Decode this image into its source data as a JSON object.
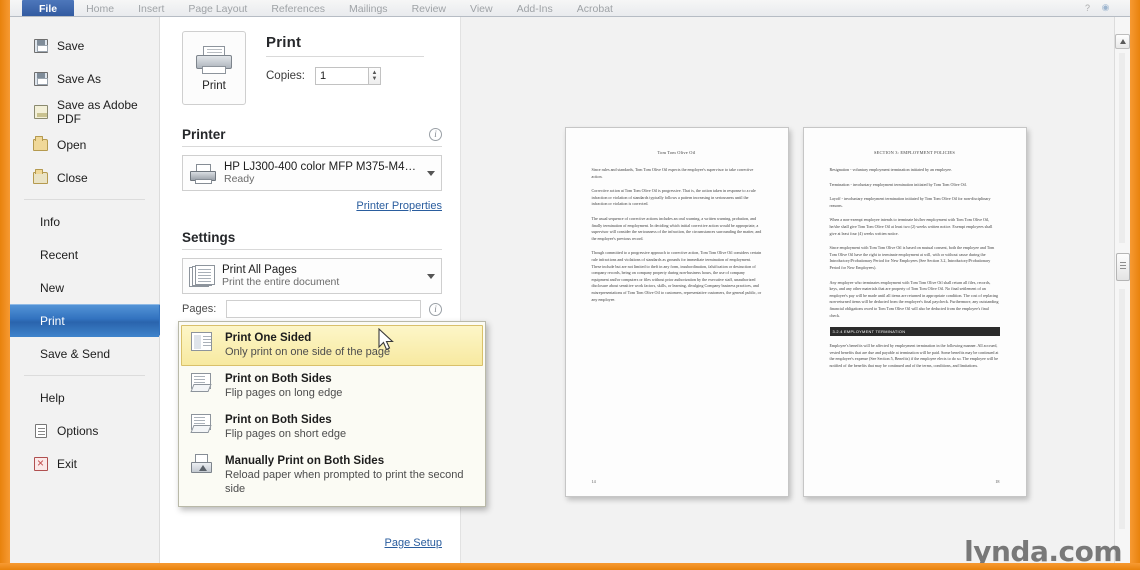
{
  "ribbon": {
    "tabs": [
      {
        "label": "File",
        "active": true
      },
      {
        "label": "Home",
        "active": false
      },
      {
        "label": "Insert",
        "active": false
      },
      {
        "label": "Page Layout",
        "active": false
      },
      {
        "label": "References",
        "active": false
      },
      {
        "label": "Mailings",
        "active": false
      },
      {
        "label": "Review",
        "active": false
      },
      {
        "label": "View",
        "active": false
      },
      {
        "label": "Add-Ins",
        "active": false
      },
      {
        "label": "Acrobat",
        "active": false
      }
    ],
    "help_icon": "help-icon",
    "globe_icon": "globe-icon"
  },
  "nav": {
    "items": [
      {
        "label": "Save",
        "icon": "save-disk-icon"
      },
      {
        "label": "Save As",
        "icon": "save-as-disk-icon"
      },
      {
        "label": "Save as Adobe PDF",
        "icon": "pdf-icon"
      },
      {
        "label": "Open",
        "icon": "open-folder-icon"
      },
      {
        "label": "Close",
        "icon": "close-folder-icon"
      },
      {
        "label": "Info",
        "icon": ""
      },
      {
        "label": "Recent",
        "icon": ""
      },
      {
        "label": "New",
        "icon": ""
      },
      {
        "label": "Print",
        "icon": "",
        "selected": true
      },
      {
        "label": "Save & Send",
        "icon": ""
      },
      {
        "label": "Help",
        "icon": ""
      },
      {
        "label": "Options",
        "icon": "options-icon"
      },
      {
        "label": "Exit",
        "icon": "exit-icon"
      }
    ]
  },
  "print_panel": {
    "button_label": "Print",
    "heading": "Print",
    "copies_label": "Copies:",
    "copies_value": "1",
    "printer_section": {
      "heading": "Printer",
      "info_badge": "i",
      "selected_printer": "HP LJ300-400 color MFP M375-M475 PCL 6",
      "status": "Ready",
      "properties_link": "Printer Properties"
    },
    "settings_section": {
      "heading": "Settings",
      "print_range": {
        "title": "Print All Pages",
        "subtitle": "Print the entire document"
      },
      "pages_label": "Pages:",
      "pages_value": "",
      "pages_placeholder": "",
      "pages_info_badge": "i",
      "sides": {
        "title": "Print One Sided",
        "subtitle": "Only print on one side of the page"
      }
    },
    "page_setup_link": "Page Setup"
  },
  "dropdown": {
    "options": [
      {
        "title": "Print One Sided",
        "subtitle": "Only print on one side of the page",
        "icon": "one-sided-page-icon",
        "selected": true
      },
      {
        "title": "Print on Both Sides",
        "subtitle": "Flip pages on long edge",
        "icon": "both-sides-long-edge-icon",
        "selected": false
      },
      {
        "title": "Print on Both Sides",
        "subtitle": "Flip pages on short edge",
        "icon": "both-sides-short-edge-icon",
        "selected": false
      },
      {
        "title": "Manually Print on Both Sides",
        "subtitle": "Reload paper when prompted to print the second side",
        "icon": "manual-both-sides-icon",
        "selected": false
      }
    ]
  },
  "preview": {
    "left_page": {
      "title": "Tom Tom Olive Oil",
      "page_number": "14",
      "paragraphs": [
        "Since rules and standards, Tom Tom Olive Oil expects the employee's supervisor to take corrective action.",
        "Corrective action at Tom Tom Olive Oil is progressive. That is, the action taken in response to a rule infraction or violation of standards typically follows a pattern increasing in seriousness until the infraction or violation is corrected.",
        "The usual sequence of corrective actions includes an oral warning, a written warning, probation, and finally termination of employment. In deciding which initial corrective action would be appropriate, a supervisor will consider the seriousness of the infraction, the circumstances surrounding the matter, and the employee's previous record.",
        "Though committed to a progressive approach to corrective action, Tom Tom Olive Oil considers certain rule infractions and violations of standards as grounds for immediate termination of employment. These include but are not limited to theft in any form, insubordination, falsification or destruction of company records, being on company property during non-business hours, the use of company equipment and/or computers or files without prior authorization by the executive staff, unauthorized disclosure about sensitive work factors, skills, or learning, divulging Company business practices, and misrepresentations of Tom Tom Olive Oil to customers, representative customers, the general public, or any employee."
      ]
    },
    "right_page": {
      "heading": "SECTION 3: EMPLOYMENT POLICIES",
      "highlight_bar": "3.2.4 EMPLOYMENT TERMINATION",
      "page_number": "18",
      "paragraphs": [
        "Resignation - voluntary employment termination initiated by an employee.",
        "Termination - involuntary employment termination initiated by Tom Tom Olive Oil.",
        "Layoff - involuntary employment termination initiated by Tom Tom Olive Oil for non-disciplinary reasons.",
        "When a non-exempt employee intends to terminate his/her employment with Tom Tom Olive Oil, he/she shall give Tom Tom Olive Oil at least two (2) weeks written notice. Exempt employees shall give at least four (4) weeks written notice.",
        "Since employment with Tom Tom Olive Oil is based on mutual consent, both the employee and Tom Tom Olive Oil have the right to terminate employment at will, with or without cause during the Introductory/Probationary Period for New Employees (See Section 3.2, Introductory/Probationary Period for New Employees).",
        "Any employee who terminates employment with Tom Tom Olive Oil shall return all files, records, keys, and any other materials that are property of Tom Tom Olive Oil. No final settlement of an employee's pay will be made until all items are returned in appropriate condition. The cost of replacing non-returned items will be deducted from the employee's final paycheck. Furthermore, any outstanding financial obligations owed to Tom Tom Olive Oil will also be deducted from the employee's final check.",
        "Employee's benefits will be affected by employment termination in the following manner. All accrued, vested benefits that are due and payable at termination will be paid. Some benefits may be continued at the employee's expense (See Section 5, Benefits) if the employee elects to do so. The employee will be notified of the benefits that may be continued and of the terms, conditions, and limitations."
      ]
    }
  },
  "scrollbar": {
    "up_arrow_icon": "scroll-up-arrow-icon",
    "thumb_icon": "scroll-thumb"
  },
  "watermark": {
    "text": "lynda.com"
  },
  "colors": {
    "accent_orange": "#e8820c",
    "selection_blue": "#3272bf",
    "highlight_yellow": "#f7e79a",
    "link_blue": "#2a5d9e"
  }
}
